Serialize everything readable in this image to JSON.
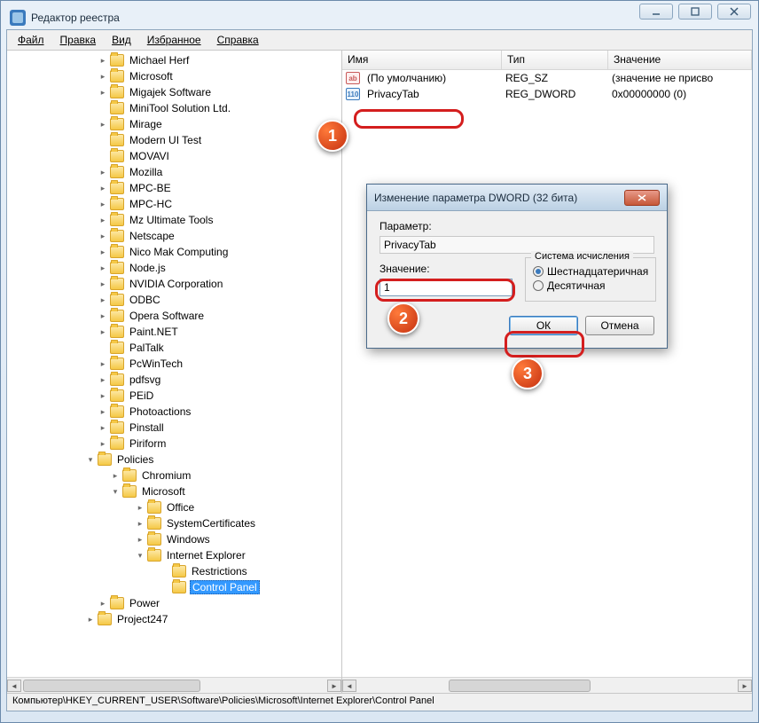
{
  "window": {
    "title": "Редактор реестра"
  },
  "menu": {
    "file": "Файл",
    "edit": "Правка",
    "view": "Вид",
    "favorites": "Избранное",
    "help": "Справка"
  },
  "tree": [
    {
      "ind": 100,
      "exp": ">",
      "label": "Michael Herf"
    },
    {
      "ind": 100,
      "exp": ">",
      "label": "Microsoft"
    },
    {
      "ind": 100,
      "exp": ">",
      "label": "Migajek Software"
    },
    {
      "ind": 100,
      "exp": "",
      "label": "MiniTool Solution Ltd."
    },
    {
      "ind": 100,
      "exp": ">",
      "label": "Mirage"
    },
    {
      "ind": 100,
      "exp": "",
      "label": "Modern UI Test"
    },
    {
      "ind": 100,
      "exp": "",
      "label": "MOVAVI"
    },
    {
      "ind": 100,
      "exp": ">",
      "label": "Mozilla"
    },
    {
      "ind": 100,
      "exp": ">",
      "label": "MPC-BE"
    },
    {
      "ind": 100,
      "exp": ">",
      "label": "MPC-HC"
    },
    {
      "ind": 100,
      "exp": ">",
      "label": "Mz Ultimate Tools"
    },
    {
      "ind": 100,
      "exp": ">",
      "label": "Netscape"
    },
    {
      "ind": 100,
      "exp": ">",
      "label": "Nico Mak Computing"
    },
    {
      "ind": 100,
      "exp": ">",
      "label": "Node.js"
    },
    {
      "ind": 100,
      "exp": ">",
      "label": "NVIDIA Corporation"
    },
    {
      "ind": 100,
      "exp": ">",
      "label": "ODBC"
    },
    {
      "ind": 100,
      "exp": ">",
      "label": "Opera Software"
    },
    {
      "ind": 100,
      "exp": ">",
      "label": "Paint.NET"
    },
    {
      "ind": 100,
      "exp": "",
      "label": "PalTalk"
    },
    {
      "ind": 100,
      "exp": ">",
      "label": "PcWinTech"
    },
    {
      "ind": 100,
      "exp": ">",
      "label": "pdfsvg"
    },
    {
      "ind": 100,
      "exp": ">",
      "label": "PEiD"
    },
    {
      "ind": 100,
      "exp": ">",
      "label": "Photoactions"
    },
    {
      "ind": 100,
      "exp": ">",
      "label": "Pinstall"
    },
    {
      "ind": 100,
      "exp": ">",
      "label": "Piriform"
    },
    {
      "ind": 86,
      "exp": "v",
      "label": "Policies"
    },
    {
      "ind": 114,
      "exp": ">",
      "label": "Chromium"
    },
    {
      "ind": 114,
      "exp": "v",
      "label": "Microsoft"
    },
    {
      "ind": 142,
      "exp": ">",
      "label": "Office"
    },
    {
      "ind": 142,
      "exp": ">",
      "label": "SystemCertificates"
    },
    {
      "ind": 142,
      "exp": ">",
      "label": "Windows"
    },
    {
      "ind": 142,
      "exp": "v",
      "label": "Internet Explorer"
    },
    {
      "ind": 170,
      "exp": "",
      "label": "Restrictions"
    },
    {
      "ind": 170,
      "exp": "",
      "label": "Control Panel",
      "selected": true
    },
    {
      "ind": 100,
      "exp": ">",
      "label": "Power"
    },
    {
      "ind": 86,
      "exp": ">",
      "label": "Project247"
    }
  ],
  "list": {
    "headers": {
      "name": "Имя",
      "type": "Тип",
      "value": "Значение"
    },
    "rows": [
      {
        "icon": "str",
        "name": "(По умолчанию)",
        "type": "REG_SZ",
        "value": "(значение не присво"
      },
      {
        "icon": "dw",
        "name": "PrivacyTab",
        "type": "REG_DWORD",
        "value": "0x00000000 (0)"
      }
    ]
  },
  "dialog": {
    "title": "Изменение параметра DWORD (32 бита)",
    "param_label": "Параметр:",
    "param_value": "PrivacyTab",
    "value_label": "Значение:",
    "value_input": "1",
    "base_group": "Система исчисления",
    "radio_hex": "Шестнадцатеричная",
    "radio_dec": "Десятичная",
    "ok": "ОК",
    "cancel": "Отмена"
  },
  "callouts": {
    "c1": "1",
    "c2": "2",
    "c3": "3"
  },
  "status": "Компьютер\\HKEY_CURRENT_USER\\Software\\Policies\\Microsoft\\Internet Explorer\\Control Panel"
}
